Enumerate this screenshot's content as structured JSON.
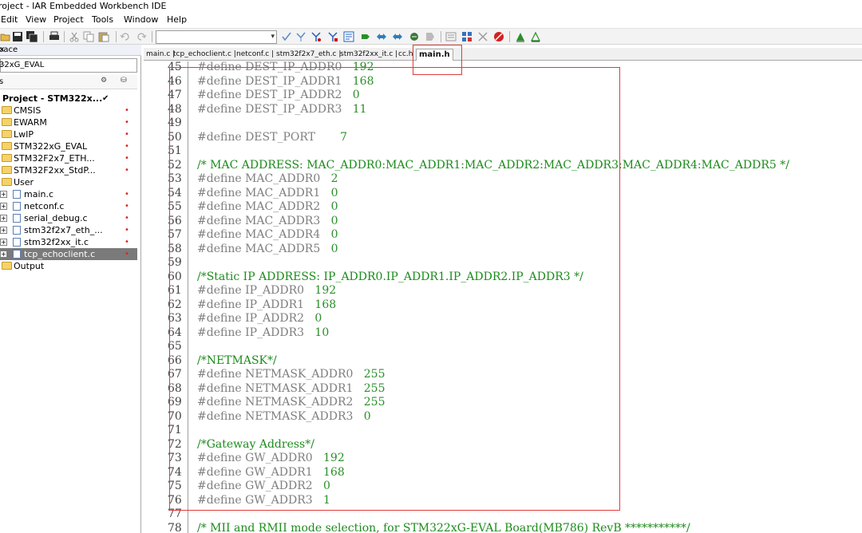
{
  "window": {
    "title": "roject - IAR Embedded Workbench IDE"
  },
  "menu": [
    "Edit",
    "View",
    "Project",
    "Tools",
    "Window",
    "Help"
  ],
  "toolbar": {
    "combo_value": "",
    "icons": [
      "open-folder-icon",
      "save-icon",
      "save-all-icon",
      "print-icon",
      "cut-icon",
      "copy-icon",
      "paste-icon",
      "undo-icon",
      "redo-icon",
      "find-icon",
      "find-next-icon",
      "toggle-bookmark-icon",
      "next-bookmark-icon",
      "goto-icon",
      "navigate-back-icon",
      "navigate-forward-icon",
      "compile-icon",
      "make-icon",
      "stop-build-icon",
      "breakpoint-icon",
      "debug-icon",
      "debug-without-download-icon"
    ]
  },
  "workspace": {
    "header": "pace",
    "close": "×",
    "config": "32xG_EVAL",
    "columns": {
      "files": "s",
      "c1": "⚙",
      "c2": "⛁"
    },
    "project": "Project - STM322x...",
    "project_check": "✔",
    "items": [
      {
        "type": "folder",
        "label": "CMSIS",
        "dot": "•"
      },
      {
        "type": "folder",
        "label": "EWARM",
        "dot": "•"
      },
      {
        "type": "folder",
        "label": "LwIP",
        "dot": "•"
      },
      {
        "type": "folder",
        "label": "STM322xG_EVAL",
        "dot": "•"
      },
      {
        "type": "folder",
        "label": "STM32F2x7_ETH...",
        "dot": "•"
      },
      {
        "type": "folder",
        "label": "STM32F2xx_StdP...",
        "dot": "•"
      },
      {
        "type": "folder",
        "label": "User",
        "dot": ""
      },
      {
        "type": "file",
        "label": "main.c",
        "dot": "•"
      },
      {
        "type": "file",
        "label": "netconf.c",
        "dot": "•"
      },
      {
        "type": "file",
        "label": "serial_debug.c",
        "dot": "•"
      },
      {
        "type": "file",
        "label": "stm32f2x7_eth_...",
        "dot": "•"
      },
      {
        "type": "file",
        "label": "stm32f2xx_it.c",
        "dot": "•"
      },
      {
        "type": "file",
        "label": "tcp_echoclient.c",
        "dot": "•",
        "selected": true
      },
      {
        "type": "folder",
        "label": "Output",
        "dot": ""
      }
    ]
  },
  "tabs": [
    {
      "label": "main.c |",
      "active": false
    },
    {
      "label": "tcp_echoclient.c |",
      "active": false
    },
    {
      "label": "netconf.c |",
      "active": false
    },
    {
      "label": "stm32f2x7_eth.c |",
      "active": false
    },
    {
      "label": "stm32f2xx_it.c |",
      "active": false
    },
    {
      "label": "cc.h |",
      "active": false
    },
    {
      "label": "main.h",
      "active": true
    }
  ],
  "code_lines": [
    {
      "n": "45",
      "kw": "#define",
      "name": " DEST_IP_ADDR0",
      "pad": "   ",
      "val": "192"
    },
    {
      "n": "46",
      "kw": "#define",
      "name": " DEST_IP_ADDR1",
      "pad": "   ",
      "val": "168"
    },
    {
      "n": "47",
      "kw": "#define",
      "name": " DEST_IP_ADDR2",
      "pad": "   ",
      "val": "0"
    },
    {
      "n": "48",
      "kw": "#define",
      "name": " DEST_IP_ADDR3",
      "pad": "   ",
      "val": "11"
    },
    {
      "n": "49"
    },
    {
      "n": "50",
      "kw": "#define",
      "name": " DEST_PORT",
      "pad": "       ",
      "val": "7"
    },
    {
      "n": "51"
    },
    {
      "n": "52",
      "cmt": "/* MAC ADDRESS: MAC_ADDR0:MAC_ADDR1:MAC_ADDR2:MAC_ADDR3:MAC_ADDR4:MAC_ADDR5 */"
    },
    {
      "n": "53",
      "kw": "#define",
      "name": " MAC_ADDR0",
      "pad": "   ",
      "val": "2"
    },
    {
      "n": "54",
      "kw": "#define",
      "name": " MAC_ADDR1",
      "pad": "   ",
      "val": "0"
    },
    {
      "n": "55",
      "kw": "#define",
      "name": " MAC_ADDR2",
      "pad": "   ",
      "val": "0"
    },
    {
      "n": "56",
      "kw": "#define",
      "name": " MAC_ADDR3",
      "pad": "   ",
      "val": "0"
    },
    {
      "n": "57",
      "kw": "#define",
      "name": " MAC_ADDR4",
      "pad": "   ",
      "val": "0"
    },
    {
      "n": "58",
      "kw": "#define",
      "name": " MAC_ADDR5",
      "pad": "   ",
      "val": "0"
    },
    {
      "n": "59"
    },
    {
      "n": "60",
      "cmt": "/*Static IP ADDRESS: IP_ADDR0.IP_ADDR1.IP_ADDR2.IP_ADDR3 */"
    },
    {
      "n": "61",
      "kw": "#define",
      "name": " IP_ADDR0",
      "pad": "   ",
      "val": "192"
    },
    {
      "n": "62",
      "kw": "#define",
      "name": " IP_ADDR1",
      "pad": "   ",
      "val": "168"
    },
    {
      "n": "63",
      "kw": "#define",
      "name": " IP_ADDR2",
      "pad": "   ",
      "val": "0"
    },
    {
      "n": "64",
      "kw": "#define",
      "name": " IP_ADDR3",
      "pad": "   ",
      "val": "10"
    },
    {
      "n": "65"
    },
    {
      "n": "66",
      "cmt": "/*NETMASK*/"
    },
    {
      "n": "67",
      "kw": "#define",
      "name": " NETMASK_ADDR0",
      "pad": "   ",
      "val": "255"
    },
    {
      "n": "68",
      "kw": "#define",
      "name": " NETMASK_ADDR1",
      "pad": "   ",
      "val": "255"
    },
    {
      "n": "69",
      "kw": "#define",
      "name": " NETMASK_ADDR2",
      "pad": "   ",
      "val": "255"
    },
    {
      "n": "70",
      "kw": "#define",
      "name": " NETMASK_ADDR3",
      "pad": "   ",
      "val": "0"
    },
    {
      "n": "71"
    },
    {
      "n": "72",
      "cmt": "/*Gateway Address*/"
    },
    {
      "n": "73",
      "kw": "#define",
      "name": " GW_ADDR0",
      "pad": "   ",
      "val": "192"
    },
    {
      "n": "74",
      "kw": "#define",
      "name": " GW_ADDR1",
      "pad": "   ",
      "val": "168"
    },
    {
      "n": "75",
      "kw": "#define",
      "name": " GW_ADDR2",
      "pad": "   ",
      "val": "0"
    },
    {
      "n": "76",
      "kw": "#define",
      "name": " GW_ADDR3",
      "pad": "   ",
      "val": "1"
    },
    {
      "n": "77"
    },
    {
      "n": "78",
      "cmt": "/* MII and RMII mode selection, for STM322xG-EVAL Board(MB786) RevB ***********/"
    }
  ],
  "colors": {
    "comment": "#1d8b1d",
    "value": "#2a8f2a",
    "keyword": "#7f7f7f",
    "annotation": "#e23a3a"
  }
}
